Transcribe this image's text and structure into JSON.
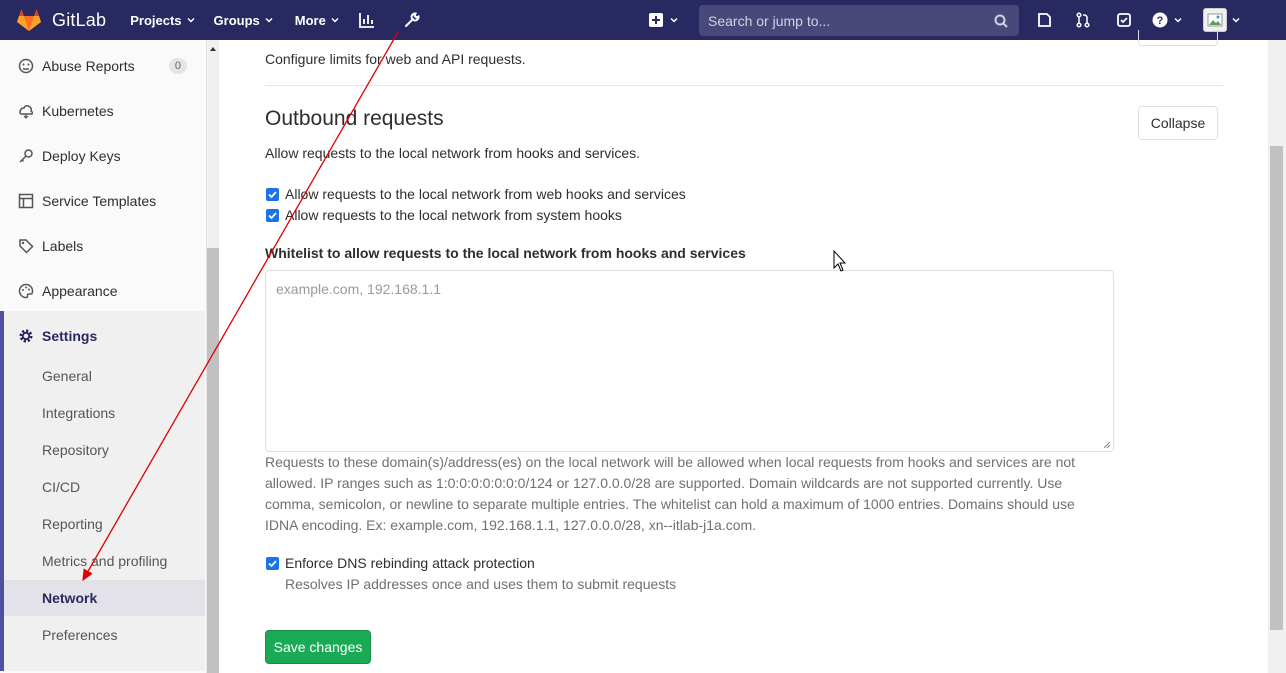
{
  "topbar": {
    "brand": "GitLab",
    "nav": [
      "Projects",
      "Groups",
      "More"
    ],
    "search_placeholder": "Search or jump to..."
  },
  "sidebar": {
    "items": [
      {
        "label": "Abuse Reports",
        "icon": "abuse-reports-icon",
        "badge": "0"
      },
      {
        "label": "Kubernetes",
        "icon": "kubernetes-icon"
      },
      {
        "label": "Deploy Keys",
        "icon": "key-icon"
      },
      {
        "label": "Service Templates",
        "icon": "service-templates-icon"
      },
      {
        "label": "Labels",
        "icon": "label-icon"
      },
      {
        "label": "Appearance",
        "icon": "appearance-icon"
      }
    ],
    "settings_label": "Settings",
    "sub_items": [
      "General",
      "Integrations",
      "Repository",
      "CI/CD",
      "Reporting",
      "Metrics and profiling",
      "Network",
      "Preferences"
    ],
    "active_sub_item": "Network"
  },
  "main": {
    "previous_section_desc": "Configure limits for web and API requests.",
    "section_title": "Outbound requests",
    "collapse_label": "Collapse",
    "section_desc": "Allow requests to the local network from hooks and services.",
    "checkboxes": [
      {
        "label": "Allow requests to the local network from web hooks and services",
        "checked": true
      },
      {
        "label": "Allow requests to the local network from system hooks",
        "checked": true
      }
    ],
    "whitelist_label": "Whitelist to allow requests to the local network from hooks and services",
    "whitelist_placeholder": "example.com, 192.168.1.1",
    "whitelist_help": "Requests to these domain(s)/address(es) on the local network will be allowed when local requests from hooks and services are not allowed. IP ranges such as 1:0:0:0:0:0:0:0/124 or 127.0.0.0/28 are supported. Domain wildcards are not supported currently. Use comma, semicolon, or newline to separate multiple entries. The whitelist can hold a maximum of 1000 entries. Domains should use IDNA encoding. Ex: example.com, 192.168.1.1, 127.0.0.0/28, xn--itlab-j1a.com.",
    "dns_label": "Enforce DNS rebinding attack protection",
    "dns_checked": true,
    "dns_help": "Resolves IP addresses once and uses them to submit requests",
    "save_label": "Save changes"
  },
  "colors": {
    "topbar": "#292961",
    "accent": "#1aaa55",
    "annotation_arrow": "#e00000"
  }
}
